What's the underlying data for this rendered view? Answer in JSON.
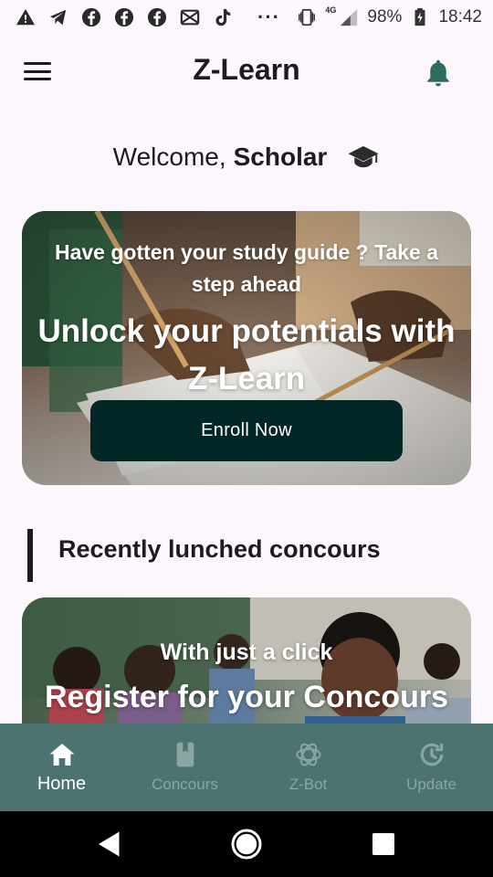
{
  "status_bar": {
    "left_icons": [
      "warning-icon",
      "telegram-icon",
      "facebook-icon",
      "facebook-icon",
      "facebook-icon",
      "mail-icon",
      "tiktok-icon"
    ],
    "more": "···",
    "network": "4G",
    "battery": "98%",
    "time": "18:42"
  },
  "app_bar": {
    "title": "Z-Learn",
    "menu_icon": "menu-icon",
    "bell_icon": "bell-icon"
  },
  "welcome": {
    "greeting": "Welcome,",
    "name": "Scholar",
    "icon": "graduation-cap-icon"
  },
  "hero_card": {
    "subtitle": "Have gotten your study guide ? Take a step ahead",
    "title": "Unlock your potentials with Z-Learn",
    "button_label": "Enroll Now"
  },
  "section": {
    "title": "Recently lunched concours"
  },
  "concours_card": {
    "subtitle": "With just a click",
    "title": "Register for your Concours"
  },
  "bottom_nav": {
    "items": [
      {
        "label": "Home",
        "icon": "home-icon",
        "active": true
      },
      {
        "label": "Concours",
        "icon": "book-icon",
        "active": false
      },
      {
        "label": "Z-Bot",
        "icon": "ai-bot-icon",
        "active": false
      },
      {
        "label": "Update",
        "icon": "update-icon",
        "active": false
      }
    ]
  },
  "colors": {
    "background": "#fcf7fc",
    "primary_dark": "#032626",
    "nav_background": "#4c7370",
    "bell": "#2c6a62"
  }
}
